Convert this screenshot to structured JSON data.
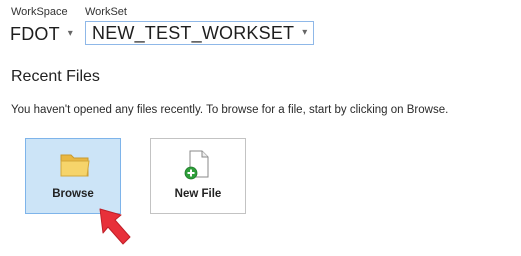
{
  "workspace": {
    "label": "WorkSpace",
    "value": "FDOT",
    "caret": "▾"
  },
  "workset": {
    "label": "WorkSet",
    "value": "NEW_TEST_WORKSET",
    "caret": "▾"
  },
  "recent_files": {
    "title": "Recent Files",
    "message": "You haven't opened any files recently.  To browse for a file, start by clicking on Browse."
  },
  "tiles": {
    "browse": {
      "label": "Browse",
      "icon": "folder-icon",
      "selected": true
    },
    "new_file": {
      "label": "New File",
      "icon": "new-file-icon"
    }
  },
  "pointer": {
    "icon": "red-arrow-pointer-icon"
  },
  "colors": {
    "selected_tile_bg": "#cce4f7",
    "selected_tile_border": "#7eb4ea",
    "folder": "#f0c552",
    "plus_badge": "#2e9e3a",
    "pointer_arrow": "#e8303a"
  }
}
